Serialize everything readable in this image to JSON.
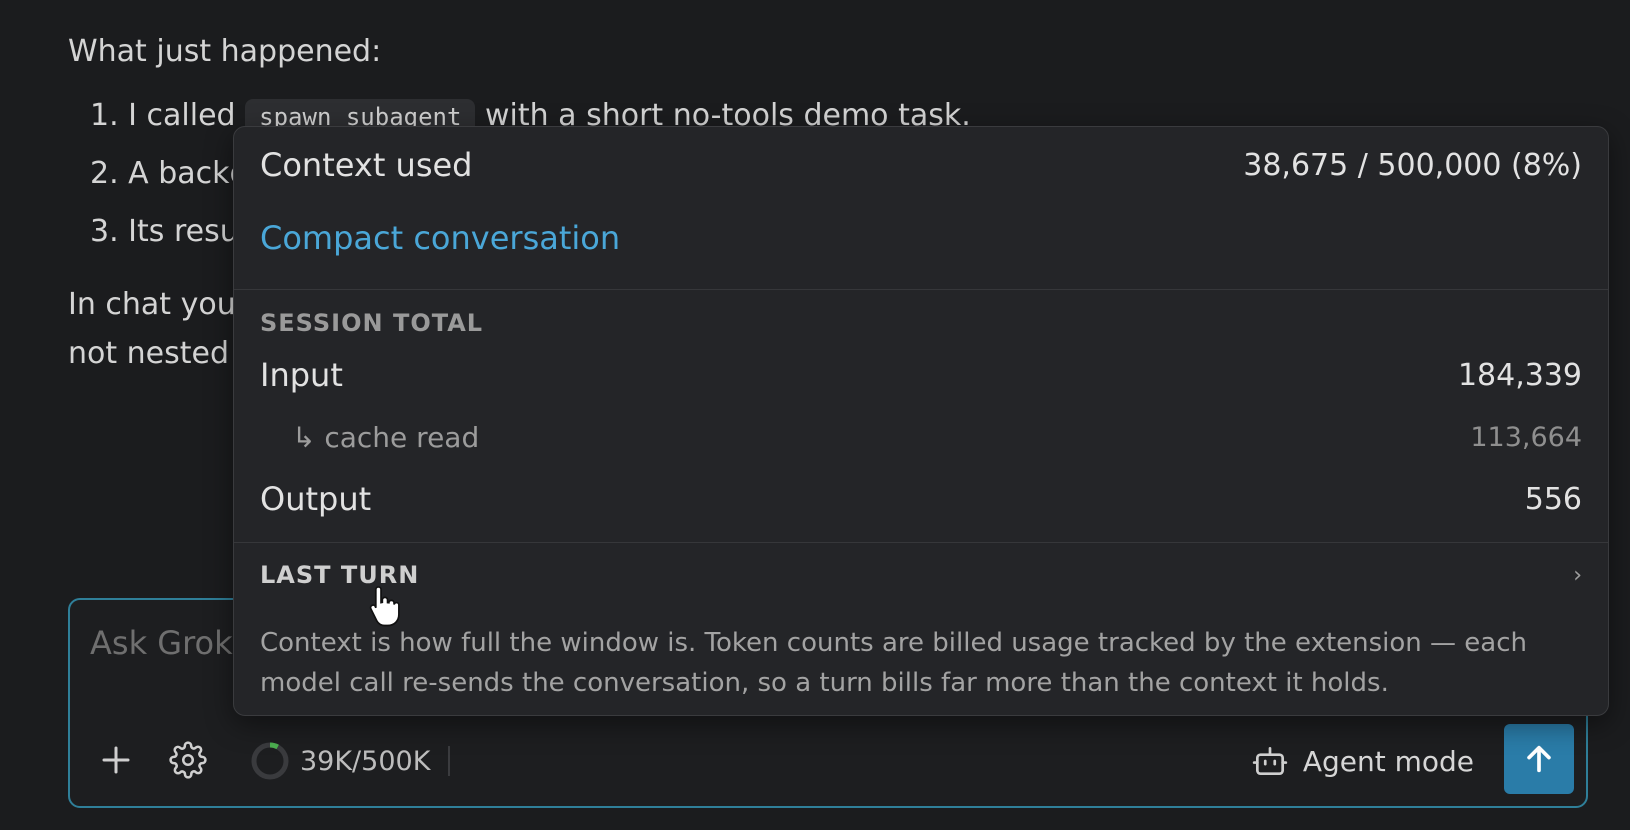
{
  "chat": {
    "heading": "What just happened:",
    "list": [
      {
        "number": "1.",
        "prefix": "I called",
        "code": "spawn_subagent",
        "suffix": "with a short no-tools demo task."
      },
      {
        "number": "2.",
        "text": "A backg"
      },
      {
        "number": "3.",
        "text": "Its resul"
      }
    ],
    "paragraph_line1": "In chat you",
    "paragraph_line2": "not nested"
  },
  "popover": {
    "context_used_label": "Context used",
    "context_used_value": "38,675 / 500,000 (8%)",
    "compact_label": "Compact conversation",
    "session_total_title": "SESSION TOTAL",
    "input_label": "Input",
    "input_value": "184,339",
    "cache_read_label": "↳ cache read",
    "cache_read_value": "113,664",
    "output_label": "Output",
    "output_value": "556",
    "last_turn_title": "LAST TURN",
    "last_turn_chevron": "›",
    "note": "Context is how full the window is. Token counts are billed usage tracked by the extension — each model call re-sends the conversation, so a turn bills far more than the context it holds."
  },
  "composer": {
    "placeholder": "Ask Grok...",
    "context_label": "39K/500K",
    "context_fraction": 0.08,
    "agent_mode_label": "Agent mode"
  },
  "icons": {
    "add": "plus-icon",
    "settings": "gear-icon",
    "agent": "robot-icon",
    "send": "arrow-up-icon"
  },
  "colors": {
    "accent": "#2a7ca8",
    "link": "#4aa7d8",
    "meter_progress": "#4caf50"
  }
}
